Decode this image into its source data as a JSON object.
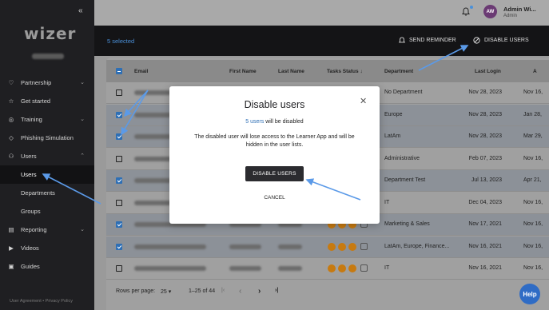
{
  "sidebar": {
    "collapse_icon": "double-chevron-left",
    "logo": "wizer",
    "items": [
      {
        "label": "Partnership",
        "icon": "handshake-icon",
        "chevron": "⌄"
      },
      {
        "label": "Get started",
        "icon": "star-icon",
        "chevron": ""
      },
      {
        "label": "Training",
        "icon": "training-icon",
        "chevron": "⌄"
      },
      {
        "label": "Phishing Simulation",
        "icon": "phishing-icon",
        "chevron": ""
      },
      {
        "label": "Users",
        "icon": "users-icon",
        "chevron": "⌃"
      },
      {
        "label": "Users",
        "sub": true,
        "active": true
      },
      {
        "label": "Departments",
        "sub": true
      },
      {
        "label": "Groups",
        "sub": true
      },
      {
        "label": "Reporting",
        "icon": "reporting-icon",
        "chevron": "⌄"
      },
      {
        "label": "Videos",
        "icon": "video-icon",
        "chevron": ""
      },
      {
        "label": "Guides",
        "icon": "guides-icon",
        "chevron": ""
      }
    ],
    "footer": "User Agreement  •  Privacy Policy"
  },
  "header": {
    "avatar_initials": "AW",
    "admin_name": "Admin Wi...",
    "admin_role": "Admin"
  },
  "actionbar": {
    "selected": "5 selected",
    "send_reminder": "SEND REMINDER",
    "disable_users": "DISABLE USERS"
  },
  "table": {
    "headers": {
      "email": "Email",
      "first_name": "First Name",
      "last_name": "Last Name",
      "tasks_status": "Tasks Status",
      "department": "Department",
      "last_login": "Last Login",
      "added": "A"
    },
    "rows": [
      {
        "checked": false,
        "department": "No Department",
        "last_login": "Nov 28, 2023",
        "added": "Nov 16,",
        "tasks": false
      },
      {
        "checked": true,
        "department": "Europe",
        "last_login": "Nov 28, 2023",
        "added": "Jan 28,",
        "tasks": false
      },
      {
        "checked": true,
        "department": "LatAm",
        "last_login": "Nov 28, 2023",
        "added": "Mar 29,",
        "tasks": false
      },
      {
        "checked": false,
        "department": "Administrative",
        "last_login": "Feb 07, 2023",
        "added": "Nov 16,",
        "tasks": false
      },
      {
        "checked": true,
        "department": "Department Test",
        "last_login": "Jul 13, 2023",
        "added": "Apr 21,",
        "tasks": false
      },
      {
        "checked": false,
        "department": "IT",
        "last_login": "Dec 04, 2023",
        "added": "Nov 16,",
        "tasks": false
      },
      {
        "checked": true,
        "department": "Marketing & Sales",
        "last_login": "Nov 17, 2021",
        "added": "Nov 16,",
        "tasks": true
      },
      {
        "checked": true,
        "department": "LatAm, Europe, Finance...",
        "last_login": "Nov 16, 2021",
        "added": "Nov 16,",
        "tasks": true
      },
      {
        "checked": false,
        "department": "IT",
        "last_login": "Nov 16, 2021",
        "added": "Nov 16,",
        "tasks": true
      }
    ],
    "pager": {
      "rows_label": "Rows per page:",
      "rows_value": "25",
      "range": "1–25 of 44",
      "first": "|‹",
      "prev": "‹",
      "next": "›",
      "last": "›|"
    }
  },
  "modal": {
    "title": "Disable users",
    "count_link": "5 users",
    "count_rest": " will be disabled",
    "description": "The disabled user will lose access to the Learner App and will be hidden in the user lists.",
    "confirm": "DISABLE USERS",
    "cancel": "CANCEL"
  },
  "help": "Help",
  "colors": {
    "accent": "#2e6fb5",
    "annotation_arrow": "#5b9ae8",
    "task_icon": "#c77a10"
  }
}
